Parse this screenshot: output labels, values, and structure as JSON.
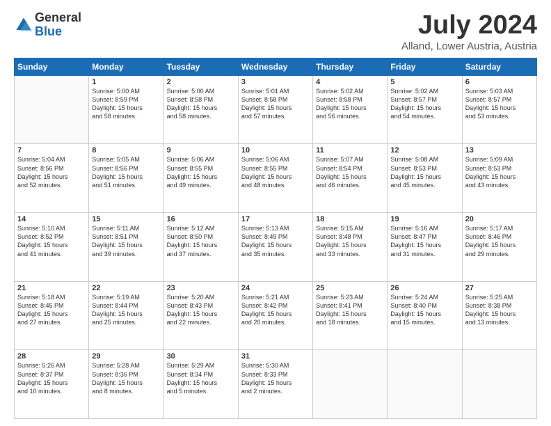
{
  "header": {
    "logo_general": "General",
    "logo_blue": "Blue",
    "month": "July 2024",
    "location": "Alland, Lower Austria, Austria"
  },
  "days_of_week": [
    "Sunday",
    "Monday",
    "Tuesday",
    "Wednesday",
    "Thursday",
    "Friday",
    "Saturday"
  ],
  "weeks": [
    [
      {
        "day": "",
        "sunrise": "",
        "sunset": "",
        "daylight": ""
      },
      {
        "day": "1",
        "sunrise": "Sunrise: 5:00 AM",
        "sunset": "Sunset: 8:59 PM",
        "daylight": "Daylight: 15 hours and 58 minutes."
      },
      {
        "day": "2",
        "sunrise": "Sunrise: 5:00 AM",
        "sunset": "Sunset: 8:58 PM",
        "daylight": "Daylight: 15 hours and 58 minutes."
      },
      {
        "day": "3",
        "sunrise": "Sunrise: 5:01 AM",
        "sunset": "Sunset: 8:58 PM",
        "daylight": "Daylight: 15 hours and 57 minutes."
      },
      {
        "day": "4",
        "sunrise": "Sunrise: 5:02 AM",
        "sunset": "Sunset: 8:58 PM",
        "daylight": "Daylight: 15 hours and 56 minutes."
      },
      {
        "day": "5",
        "sunrise": "Sunrise: 5:02 AM",
        "sunset": "Sunset: 8:57 PM",
        "daylight": "Daylight: 15 hours and 54 minutes."
      },
      {
        "day": "6",
        "sunrise": "Sunrise: 5:03 AM",
        "sunset": "Sunset: 8:57 PM",
        "daylight": "Daylight: 15 hours and 53 minutes."
      }
    ],
    [
      {
        "day": "7",
        "sunrise": "Sunrise: 5:04 AM",
        "sunset": "Sunset: 8:56 PM",
        "daylight": "Daylight: 15 hours and 52 minutes."
      },
      {
        "day": "8",
        "sunrise": "Sunrise: 5:05 AM",
        "sunset": "Sunset: 8:56 PM",
        "daylight": "Daylight: 15 hours and 51 minutes."
      },
      {
        "day": "9",
        "sunrise": "Sunrise: 5:06 AM",
        "sunset": "Sunset: 8:55 PM",
        "daylight": "Daylight: 15 hours and 49 minutes."
      },
      {
        "day": "10",
        "sunrise": "Sunrise: 5:06 AM",
        "sunset": "Sunset: 8:55 PM",
        "daylight": "Daylight: 15 hours and 48 minutes."
      },
      {
        "day": "11",
        "sunrise": "Sunrise: 5:07 AM",
        "sunset": "Sunset: 8:54 PM",
        "daylight": "Daylight: 15 hours and 46 minutes."
      },
      {
        "day": "12",
        "sunrise": "Sunrise: 5:08 AM",
        "sunset": "Sunset: 8:53 PM",
        "daylight": "Daylight: 15 hours and 45 minutes."
      },
      {
        "day": "13",
        "sunrise": "Sunrise: 5:09 AM",
        "sunset": "Sunset: 8:53 PM",
        "daylight": "Daylight: 15 hours and 43 minutes."
      }
    ],
    [
      {
        "day": "14",
        "sunrise": "Sunrise: 5:10 AM",
        "sunset": "Sunset: 8:52 PM",
        "daylight": "Daylight: 15 hours and 41 minutes."
      },
      {
        "day": "15",
        "sunrise": "Sunrise: 5:11 AM",
        "sunset": "Sunset: 8:51 PM",
        "daylight": "Daylight: 15 hours and 39 minutes."
      },
      {
        "day": "16",
        "sunrise": "Sunrise: 5:12 AM",
        "sunset": "Sunset: 8:50 PM",
        "daylight": "Daylight: 15 hours and 37 minutes."
      },
      {
        "day": "17",
        "sunrise": "Sunrise: 5:13 AM",
        "sunset": "Sunset: 8:49 PM",
        "daylight": "Daylight: 15 hours and 35 minutes."
      },
      {
        "day": "18",
        "sunrise": "Sunrise: 5:15 AM",
        "sunset": "Sunset: 8:48 PM",
        "daylight": "Daylight: 15 hours and 33 minutes."
      },
      {
        "day": "19",
        "sunrise": "Sunrise: 5:16 AM",
        "sunset": "Sunset: 8:47 PM",
        "daylight": "Daylight: 15 hours and 31 minutes."
      },
      {
        "day": "20",
        "sunrise": "Sunrise: 5:17 AM",
        "sunset": "Sunset: 8:46 PM",
        "daylight": "Daylight: 15 hours and 29 minutes."
      }
    ],
    [
      {
        "day": "21",
        "sunrise": "Sunrise: 5:18 AM",
        "sunset": "Sunset: 8:45 PM",
        "daylight": "Daylight: 15 hours and 27 minutes."
      },
      {
        "day": "22",
        "sunrise": "Sunrise: 5:19 AM",
        "sunset": "Sunset: 8:44 PM",
        "daylight": "Daylight: 15 hours and 25 minutes."
      },
      {
        "day": "23",
        "sunrise": "Sunrise: 5:20 AM",
        "sunset": "Sunset: 8:43 PM",
        "daylight": "Daylight: 15 hours and 22 minutes."
      },
      {
        "day": "24",
        "sunrise": "Sunrise: 5:21 AM",
        "sunset": "Sunset: 8:42 PM",
        "daylight": "Daylight: 15 hours and 20 minutes."
      },
      {
        "day": "25",
        "sunrise": "Sunrise: 5:23 AM",
        "sunset": "Sunset: 8:41 PM",
        "daylight": "Daylight: 15 hours and 18 minutes."
      },
      {
        "day": "26",
        "sunrise": "Sunrise: 5:24 AM",
        "sunset": "Sunset: 8:40 PM",
        "daylight": "Daylight: 15 hours and 15 minutes."
      },
      {
        "day": "27",
        "sunrise": "Sunrise: 5:25 AM",
        "sunset": "Sunset: 8:38 PM",
        "daylight": "Daylight: 15 hours and 13 minutes."
      }
    ],
    [
      {
        "day": "28",
        "sunrise": "Sunrise: 5:26 AM",
        "sunset": "Sunset: 8:37 PM",
        "daylight": "Daylight: 15 hours and 10 minutes."
      },
      {
        "day": "29",
        "sunrise": "Sunrise: 5:28 AM",
        "sunset": "Sunset: 8:36 PM",
        "daylight": "Daylight: 15 hours and 8 minutes."
      },
      {
        "day": "30",
        "sunrise": "Sunrise: 5:29 AM",
        "sunset": "Sunset: 8:34 PM",
        "daylight": "Daylight: 15 hours and 5 minutes."
      },
      {
        "day": "31",
        "sunrise": "Sunrise: 5:30 AM",
        "sunset": "Sunset: 8:33 PM",
        "daylight": "Daylight: 15 hours and 2 minutes."
      },
      {
        "day": "",
        "sunrise": "",
        "sunset": "",
        "daylight": ""
      },
      {
        "day": "",
        "sunrise": "",
        "sunset": "",
        "daylight": ""
      },
      {
        "day": "",
        "sunrise": "",
        "sunset": "",
        "daylight": ""
      }
    ]
  ]
}
